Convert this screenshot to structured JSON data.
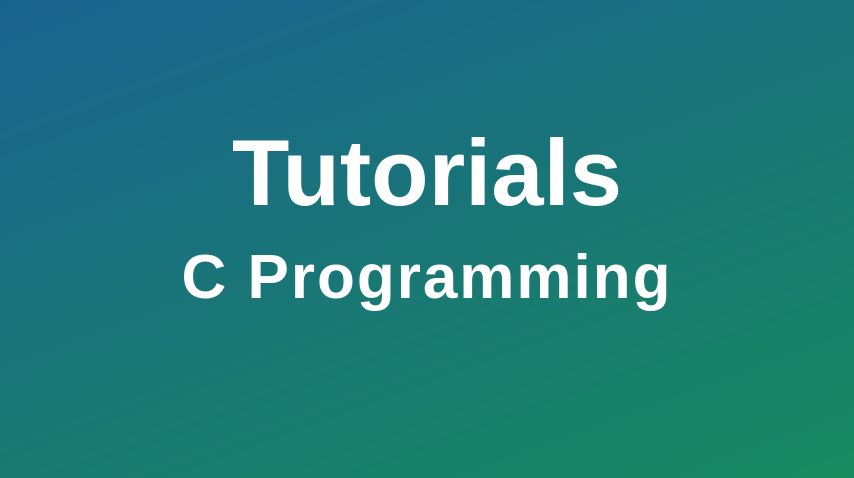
{
  "banner": {
    "title": "Tutorials",
    "subtitle": "C Programming",
    "text_color": "#ffffff",
    "gradient_colors": [
      "#1a6391",
      "#197676",
      "#188a60"
    ]
  }
}
